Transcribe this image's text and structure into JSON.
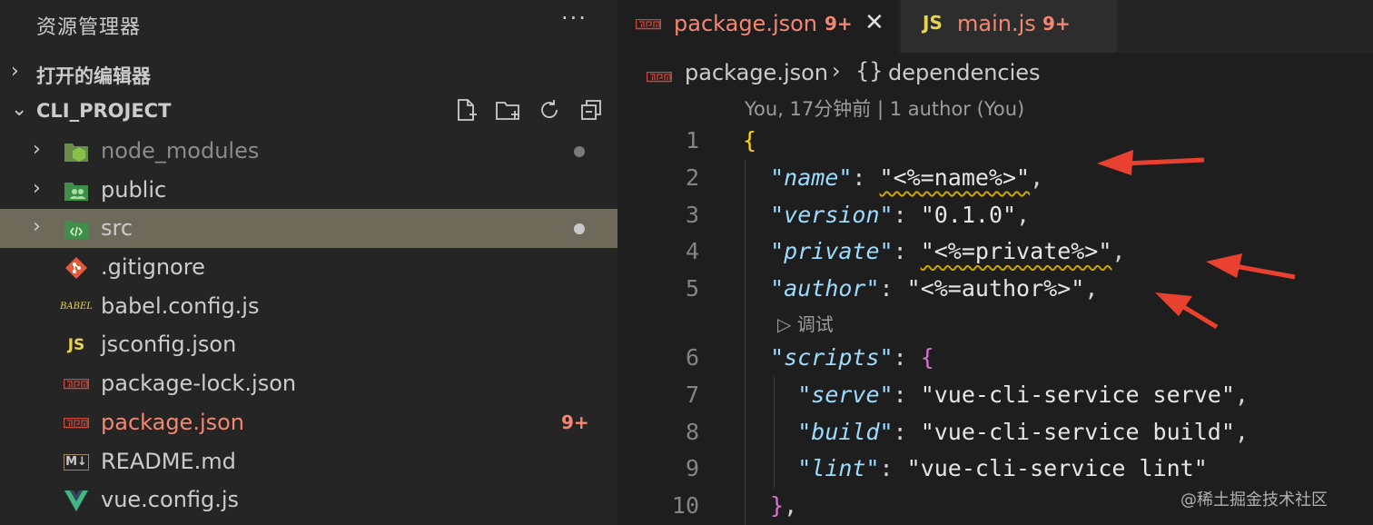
{
  "sidebar": {
    "title": "资源管理器",
    "more_label": "···",
    "open_editors_label": "打开的编辑器",
    "project_label": "CLI_PROJECT",
    "items": [
      {
        "label": "node_modules",
        "chev": "›"
      },
      {
        "label": "public",
        "chev": "›"
      },
      {
        "label": "src",
        "chev": "›"
      },
      {
        "label": ".gitignore"
      },
      {
        "label": "babel.config.js",
        "icon_text": "BABEL"
      },
      {
        "label": "jsconfig.json",
        "icon_text": "JS"
      },
      {
        "label": "package-lock.json"
      },
      {
        "label": "package.json",
        "badge": "9+"
      },
      {
        "label": "README.md",
        "icon_text": "M↓"
      },
      {
        "label": "vue.config.js"
      }
    ]
  },
  "tabs": [
    {
      "label": "package.json",
      "badge": "9+",
      "close": "✕"
    },
    {
      "label": "main.js",
      "badge": "9+",
      "icon_text": "JS"
    }
  ],
  "breadcrumb": {
    "file": "package.json",
    "separator": "›",
    "symbol": "{}",
    "node": "dependencies"
  },
  "codelens": {
    "author": "You, 17分钟前 | 1 author (You)",
    "debug": "▷ 调试"
  },
  "code": {
    "line_numbers": [
      "1",
      "2",
      "3",
      "4",
      "5",
      "6",
      "7",
      "8",
      "9",
      "10"
    ],
    "open_brace": "{",
    "name_key": "\"name\"",
    "name_val": "\"<%=name%>\"",
    "version_key": "\"version\"",
    "version_val": "\"0.1.0\"",
    "private_key": "\"private\"",
    "private_val": "\"<%=private%>\"",
    "author_key": "\"author\"",
    "author_val": "\"<%=author%>\"",
    "scripts_key": "\"scripts\"",
    "scripts_open": "{",
    "serve_key": "\"serve\"",
    "serve_val": "\"vue-cli-service serve\"",
    "build_key": "\"build\"",
    "build_val": "\"vue-cli-service build\"",
    "lint_key": "\"lint\"",
    "lint_val": "\"vue-cli-service lint\"",
    "scripts_close": "}",
    "colon": ": ",
    "comma": ","
  },
  "watermark": "@稀土掘金技术社区",
  "colors": {
    "error": "#f48771",
    "key": "#9cdcfe",
    "bracket_level1": "#ffd700",
    "bracket_level2": "#da70d6",
    "arrow": "#e8412f",
    "selection": "#6e6a5a"
  }
}
